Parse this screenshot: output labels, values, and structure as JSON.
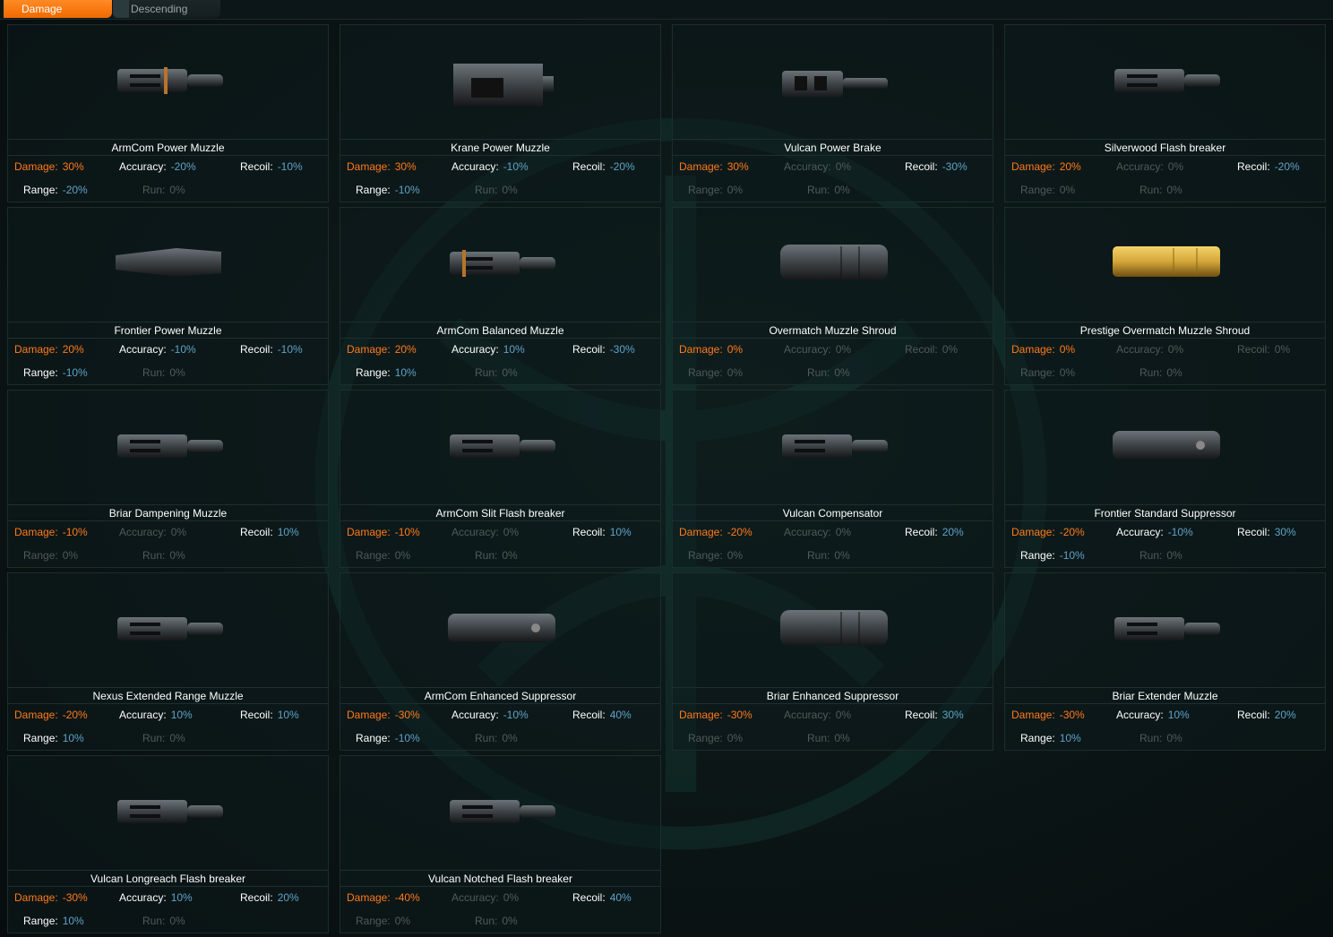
{
  "sort_tab": {
    "label": "Damage"
  },
  "order_tab": {
    "label": "Descending"
  },
  "colors": {
    "accent": "#ff7a1a",
    "value_blue": "#5fa3c8",
    "dim": "#505a5b",
    "gold": "#d4a63a"
  },
  "stat_labels": {
    "damage": "Damage:",
    "accuracy": "Accuracy:",
    "recoil": "Recoil:",
    "range": "Range:",
    "run": "Run:"
  },
  "items": [
    {
      "name": "ArmCom Power Muzzle",
      "icon": "muzzle-power-icon",
      "damage": "30%",
      "accuracy": "-20%",
      "recoil": "-10%",
      "range": "-20%",
      "run": "0%"
    },
    {
      "name": "Krane Power Muzzle",
      "icon": "muzzle-box-icon",
      "damage": "30%",
      "accuracy": "-10%",
      "recoil": "-20%",
      "range": "-10%",
      "run": "0%"
    },
    {
      "name": "Vulcan Power Brake",
      "icon": "muzzle-brake-icon",
      "damage": "30%",
      "accuracy": "0%",
      "recoil": "-30%",
      "range": "0%",
      "run": "0%"
    },
    {
      "name": "Silverwood Flash breaker",
      "icon": "flash-breaker-icon",
      "damage": "20%",
      "accuracy": "0%",
      "recoil": "-20%",
      "range": "0%",
      "run": "0%"
    },
    {
      "name": "Frontier Power Muzzle",
      "icon": "muzzle-cone-icon",
      "damage": "20%",
      "accuracy": "-10%",
      "recoil": "-10%",
      "range": "-10%",
      "run": "0%"
    },
    {
      "name": "ArmCom Balanced Muzzle",
      "icon": "muzzle-balanced-icon",
      "damage": "20%",
      "accuracy": "10%",
      "recoil": "-30%",
      "range": "10%",
      "run": "0%"
    },
    {
      "name": "Overmatch Muzzle Shroud",
      "icon": "shroud-icon",
      "damage": "0%",
      "accuracy": "0%",
      "recoil": "0%",
      "range": "0%",
      "run": "0%"
    },
    {
      "name": "Prestige Overmatch Muzzle Shroud",
      "icon": "gold-shroud-icon",
      "damage": "0%",
      "accuracy": "0%",
      "recoil": "0%",
      "range": "0%",
      "run": "0%"
    },
    {
      "name": "Briar Dampening Muzzle",
      "icon": "flash-breaker-icon",
      "damage": "-10%",
      "accuracy": "0%",
      "recoil": "10%",
      "range": "0%",
      "run": "0%"
    },
    {
      "name": "ArmCom Slit Flash breaker",
      "icon": "slit-flash-icon",
      "damage": "-10%",
      "accuracy": "0%",
      "recoil": "10%",
      "range": "0%",
      "run": "0%"
    },
    {
      "name": "Vulcan Compensator",
      "icon": "compensator-icon",
      "damage": "-20%",
      "accuracy": "0%",
      "recoil": "20%",
      "range": "0%",
      "run": "0%"
    },
    {
      "name": "Frontier Standard Suppressor",
      "icon": "suppressor-icon",
      "damage": "-20%",
      "accuracy": "-10%",
      "recoil": "30%",
      "range": "-10%",
      "run": "0%"
    },
    {
      "name": "Nexus Extended Range Muzzle",
      "icon": "extended-muzzle-icon",
      "damage": "-20%",
      "accuracy": "10%",
      "recoil": "10%",
      "range": "10%",
      "run": "0%"
    },
    {
      "name": "ArmCom Enhanced Suppressor",
      "icon": "suppressor-icon",
      "damage": "-30%",
      "accuracy": "-10%",
      "recoil": "40%",
      "range": "-10%",
      "run": "0%"
    },
    {
      "name": "Briar Enhanced Suppressor",
      "icon": "fat-suppressor-icon",
      "damage": "-30%",
      "accuracy": "0%",
      "recoil": "30%",
      "range": "0%",
      "run": "0%"
    },
    {
      "name": "Briar Extender Muzzle",
      "icon": "extender-icon",
      "damage": "-30%",
      "accuracy": "10%",
      "recoil": "20%",
      "range": "10%",
      "run": "0%"
    },
    {
      "name": "Vulcan Longreach Flash breaker",
      "icon": "longreach-icon",
      "damage": "-30%",
      "accuracy": "10%",
      "recoil": "20%",
      "range": "10%",
      "run": "0%"
    },
    {
      "name": "Vulcan Notched Flash breaker",
      "icon": "notched-icon",
      "damage": "-40%",
      "accuracy": "0%",
      "recoil": "40%",
      "range": "0%",
      "run": "0%"
    }
  ]
}
